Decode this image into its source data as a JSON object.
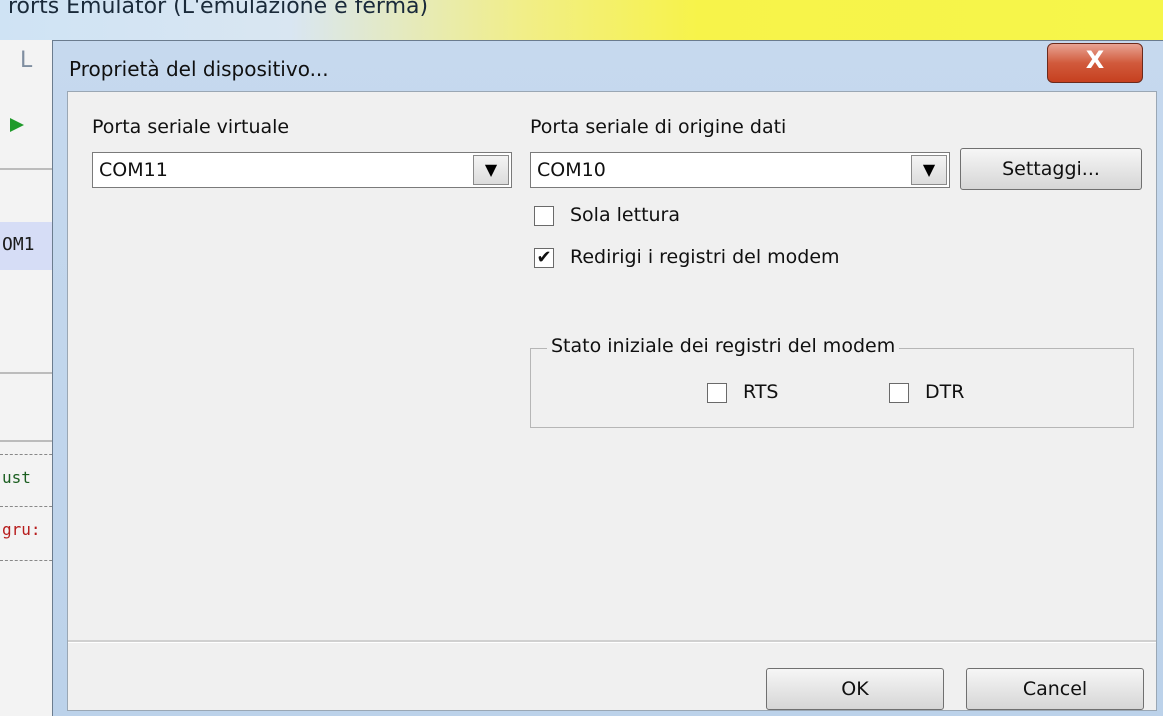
{
  "background_app": {
    "title": "rorts Emulator (L'emulazione è ferma)",
    "toolbar_letter": "L",
    "com_label": "OM1",
    "row1_text": "ust",
    "row2_text": "gru:"
  },
  "dialog": {
    "title": "Proprietà del dispositivo...",
    "close_glyph": "X",
    "virtual_port": {
      "label": "Porta seriale virtuale",
      "value": "COM11"
    },
    "source_port": {
      "label": "Porta seriale di origine dati",
      "value": "COM10"
    },
    "settings_button": "Settaggi...",
    "read_only": {
      "label": "Sola lettura",
      "checked": false
    },
    "redirect_modem": {
      "label": "Redirigi i registri del modem",
      "checked": true
    },
    "modem_group": {
      "legend": "Stato iniziale dei registri del modem",
      "rts": {
        "label": "RTS",
        "checked": false
      },
      "dtr": {
        "label": "DTR",
        "checked": false
      }
    },
    "ok_button": "OK",
    "cancel_button": "Cancel"
  },
  "colors": {
    "close_button": "#c6401f",
    "dialog_frame": "#bcd2ea",
    "client_area": "#f0f0f0",
    "play_icon": "#1f9a2a"
  }
}
